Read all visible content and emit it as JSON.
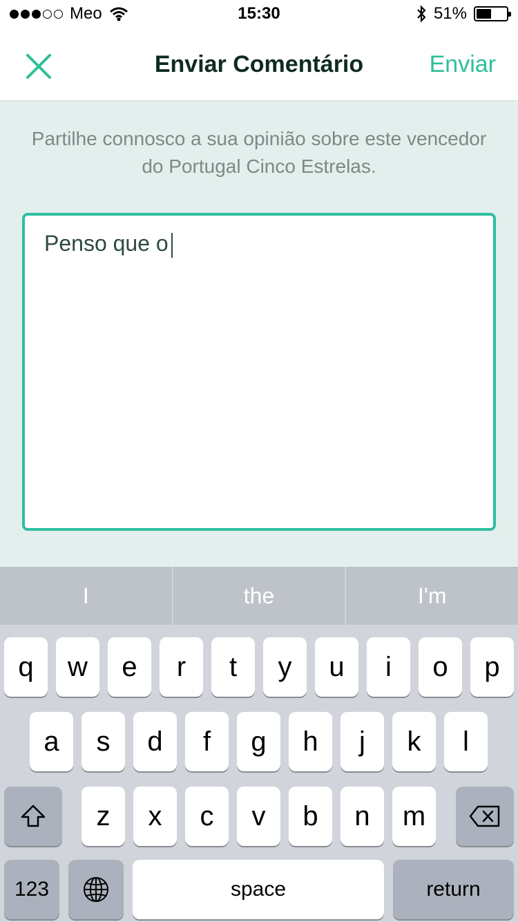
{
  "status_bar": {
    "carrier": "Meo",
    "time": "15:30",
    "battery": "51%",
    "battery_level": 0.51
  },
  "nav": {
    "title": "Enviar Comentário",
    "send_label": "Enviar"
  },
  "main": {
    "prompt": "Partilhe connosco a sua opinião sobre este vencedor do Portugal Cinco Estrelas.",
    "comment_value": "Penso que o"
  },
  "keyboard": {
    "suggestions": [
      "I",
      "the",
      "I'm"
    ],
    "row1": [
      "q",
      "w",
      "e",
      "r",
      "t",
      "y",
      "u",
      "i",
      "o",
      "p"
    ],
    "row2": [
      "a",
      "s",
      "d",
      "f",
      "g",
      "h",
      "j",
      "k",
      "l"
    ],
    "row3": [
      "z",
      "x",
      "c",
      "v",
      "b",
      "n",
      "m"
    ],
    "numbers_label": "123",
    "space_label": "space",
    "return_label": "return"
  },
  "icons": {
    "close": "close-icon",
    "shift": "shift-icon",
    "backspace": "backspace-icon",
    "globe": "globe-icon",
    "wifi": "wifi-icon",
    "bluetooth": "bluetooth-icon",
    "battery": "battery-icon"
  },
  "colors": {
    "accent": "#2fbf98",
    "title": "#0f2a24",
    "content_bg": "#e3efec"
  }
}
